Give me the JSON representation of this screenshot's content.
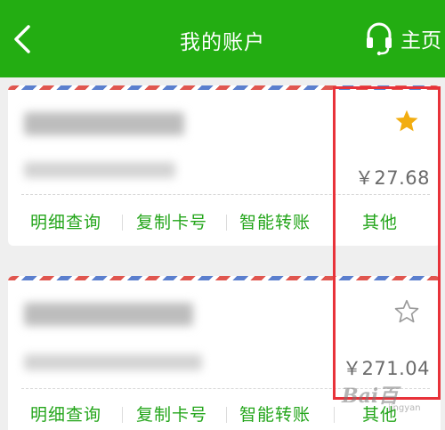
{
  "header": {
    "title": "我的账户",
    "home_label": "主页",
    "background_color": "#23ad12"
  },
  "accounts": [
    {
      "starred": true,
      "amount": "￥27.68",
      "actions": [
        "明细查询",
        "复制卡号",
        "智能转账",
        "其他"
      ]
    },
    {
      "starred": false,
      "amount": "￥271.04",
      "actions": [
        "明细查询",
        "复制卡号",
        "智能转账",
        "其他"
      ]
    }
  ],
  "colors": {
    "accent": "#23ad12",
    "action_text": "#23a51a",
    "star_filled": "#f2ad10",
    "highlight_border": "#e8323a"
  },
  "icons": {
    "back": "chevron-left-icon",
    "home": "headset-icon",
    "star_filled": "star-filled-icon",
    "star_empty": "star-outline-icon"
  },
  "watermark": {
    "brand": "Bai百",
    "sub": "jingyan"
  }
}
